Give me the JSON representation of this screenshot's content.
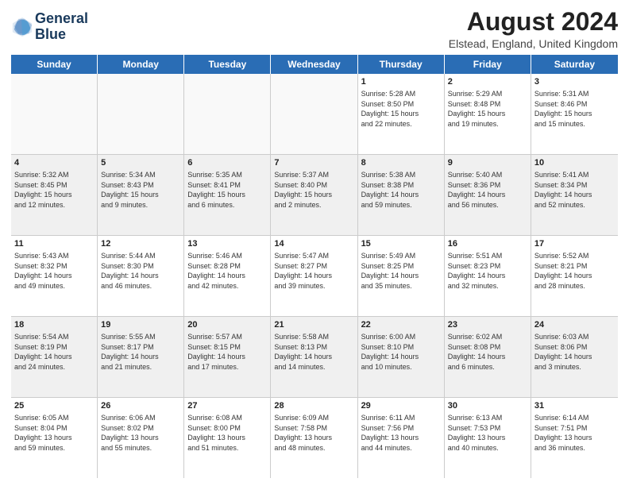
{
  "header": {
    "logo_line1": "General",
    "logo_line2": "Blue",
    "month_year": "August 2024",
    "location": "Elstead, England, United Kingdom"
  },
  "days_of_week": [
    "Sunday",
    "Monday",
    "Tuesday",
    "Wednesday",
    "Thursday",
    "Friday",
    "Saturday"
  ],
  "weeks": [
    [
      {
        "day": "",
        "lines": []
      },
      {
        "day": "",
        "lines": []
      },
      {
        "day": "",
        "lines": []
      },
      {
        "day": "",
        "lines": []
      },
      {
        "day": "1",
        "lines": [
          "Sunrise: 5:28 AM",
          "Sunset: 8:50 PM",
          "Daylight: 15 hours",
          "and 22 minutes."
        ]
      },
      {
        "day": "2",
        "lines": [
          "Sunrise: 5:29 AM",
          "Sunset: 8:48 PM",
          "Daylight: 15 hours",
          "and 19 minutes."
        ]
      },
      {
        "day": "3",
        "lines": [
          "Sunrise: 5:31 AM",
          "Sunset: 8:46 PM",
          "Daylight: 15 hours",
          "and 15 minutes."
        ]
      }
    ],
    [
      {
        "day": "4",
        "lines": [
          "Sunrise: 5:32 AM",
          "Sunset: 8:45 PM",
          "Daylight: 15 hours",
          "and 12 minutes."
        ]
      },
      {
        "day": "5",
        "lines": [
          "Sunrise: 5:34 AM",
          "Sunset: 8:43 PM",
          "Daylight: 15 hours",
          "and 9 minutes."
        ]
      },
      {
        "day": "6",
        "lines": [
          "Sunrise: 5:35 AM",
          "Sunset: 8:41 PM",
          "Daylight: 15 hours",
          "and 6 minutes."
        ]
      },
      {
        "day": "7",
        "lines": [
          "Sunrise: 5:37 AM",
          "Sunset: 8:40 PM",
          "Daylight: 15 hours",
          "and 2 minutes."
        ]
      },
      {
        "day": "8",
        "lines": [
          "Sunrise: 5:38 AM",
          "Sunset: 8:38 PM",
          "Daylight: 14 hours",
          "and 59 minutes."
        ]
      },
      {
        "day": "9",
        "lines": [
          "Sunrise: 5:40 AM",
          "Sunset: 8:36 PM",
          "Daylight: 14 hours",
          "and 56 minutes."
        ]
      },
      {
        "day": "10",
        "lines": [
          "Sunrise: 5:41 AM",
          "Sunset: 8:34 PM",
          "Daylight: 14 hours",
          "and 52 minutes."
        ]
      }
    ],
    [
      {
        "day": "11",
        "lines": [
          "Sunrise: 5:43 AM",
          "Sunset: 8:32 PM",
          "Daylight: 14 hours",
          "and 49 minutes."
        ]
      },
      {
        "day": "12",
        "lines": [
          "Sunrise: 5:44 AM",
          "Sunset: 8:30 PM",
          "Daylight: 14 hours",
          "and 46 minutes."
        ]
      },
      {
        "day": "13",
        "lines": [
          "Sunrise: 5:46 AM",
          "Sunset: 8:28 PM",
          "Daylight: 14 hours",
          "and 42 minutes."
        ]
      },
      {
        "day": "14",
        "lines": [
          "Sunrise: 5:47 AM",
          "Sunset: 8:27 PM",
          "Daylight: 14 hours",
          "and 39 minutes."
        ]
      },
      {
        "day": "15",
        "lines": [
          "Sunrise: 5:49 AM",
          "Sunset: 8:25 PM",
          "Daylight: 14 hours",
          "and 35 minutes."
        ]
      },
      {
        "day": "16",
        "lines": [
          "Sunrise: 5:51 AM",
          "Sunset: 8:23 PM",
          "Daylight: 14 hours",
          "and 32 minutes."
        ]
      },
      {
        "day": "17",
        "lines": [
          "Sunrise: 5:52 AM",
          "Sunset: 8:21 PM",
          "Daylight: 14 hours",
          "and 28 minutes."
        ]
      }
    ],
    [
      {
        "day": "18",
        "lines": [
          "Sunrise: 5:54 AM",
          "Sunset: 8:19 PM",
          "Daylight: 14 hours",
          "and 24 minutes."
        ]
      },
      {
        "day": "19",
        "lines": [
          "Sunrise: 5:55 AM",
          "Sunset: 8:17 PM",
          "Daylight: 14 hours",
          "and 21 minutes."
        ]
      },
      {
        "day": "20",
        "lines": [
          "Sunrise: 5:57 AM",
          "Sunset: 8:15 PM",
          "Daylight: 14 hours",
          "and 17 minutes."
        ]
      },
      {
        "day": "21",
        "lines": [
          "Sunrise: 5:58 AM",
          "Sunset: 8:13 PM",
          "Daylight: 14 hours",
          "and 14 minutes."
        ]
      },
      {
        "day": "22",
        "lines": [
          "Sunrise: 6:00 AM",
          "Sunset: 8:10 PM",
          "Daylight: 14 hours",
          "and 10 minutes."
        ]
      },
      {
        "day": "23",
        "lines": [
          "Sunrise: 6:02 AM",
          "Sunset: 8:08 PM",
          "Daylight: 14 hours",
          "and 6 minutes."
        ]
      },
      {
        "day": "24",
        "lines": [
          "Sunrise: 6:03 AM",
          "Sunset: 8:06 PM",
          "Daylight: 14 hours",
          "and 3 minutes."
        ]
      }
    ],
    [
      {
        "day": "25",
        "lines": [
          "Sunrise: 6:05 AM",
          "Sunset: 8:04 PM",
          "Daylight: 13 hours",
          "and 59 minutes."
        ]
      },
      {
        "day": "26",
        "lines": [
          "Sunrise: 6:06 AM",
          "Sunset: 8:02 PM",
          "Daylight: 13 hours",
          "and 55 minutes."
        ]
      },
      {
        "day": "27",
        "lines": [
          "Sunrise: 6:08 AM",
          "Sunset: 8:00 PM",
          "Daylight: 13 hours",
          "and 51 minutes."
        ]
      },
      {
        "day": "28",
        "lines": [
          "Sunrise: 6:09 AM",
          "Sunset: 7:58 PM",
          "Daylight: 13 hours",
          "and 48 minutes."
        ]
      },
      {
        "day": "29",
        "lines": [
          "Sunrise: 6:11 AM",
          "Sunset: 7:56 PM",
          "Daylight: 13 hours",
          "and 44 minutes."
        ]
      },
      {
        "day": "30",
        "lines": [
          "Sunrise: 6:13 AM",
          "Sunset: 7:53 PM",
          "Daylight: 13 hours",
          "and 40 minutes."
        ]
      },
      {
        "day": "31",
        "lines": [
          "Sunrise: 6:14 AM",
          "Sunset: 7:51 PM",
          "Daylight: 13 hours",
          "and 36 minutes."
        ]
      }
    ]
  ]
}
